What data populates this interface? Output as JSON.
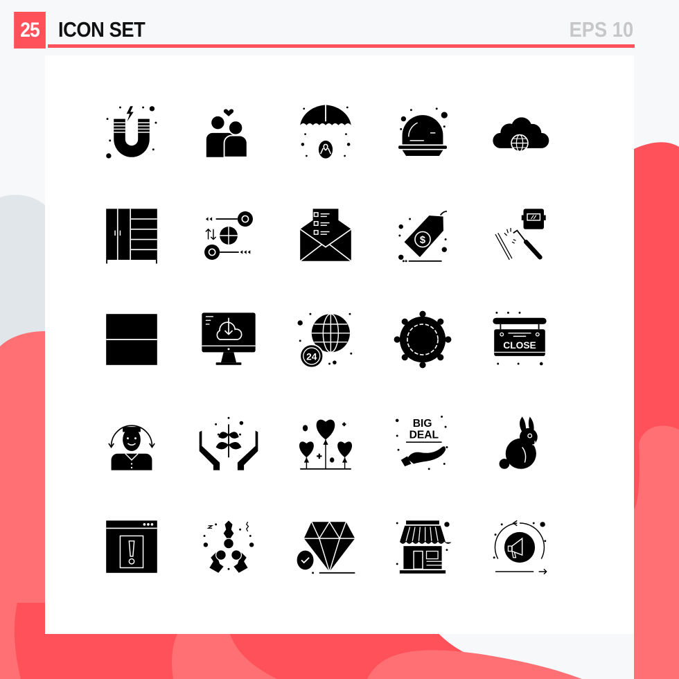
{
  "header": {
    "count_badge": "25",
    "title": "ICON SET",
    "format_label": "EPS 10"
  },
  "colors": {
    "accent": "#ff5159",
    "accent_light": "#ff7074",
    "grey_shape": "#e1e6ea",
    "background": "#f7f8fa",
    "card": "#ffffff",
    "icon": "#000000",
    "format_label": "#c7c7c9"
  },
  "icons": [
    {
      "row": 1,
      "col": 1,
      "name": "magnet-icon"
    },
    {
      "row": 1,
      "col": 2,
      "name": "couple-love-icon"
    },
    {
      "row": 1,
      "col": 3,
      "name": "umbrella-ribbon-icon"
    },
    {
      "row": 1,
      "col": 4,
      "name": "food-cloche-icon"
    },
    {
      "row": 1,
      "col": 5,
      "name": "cloud-globe-icon"
    },
    {
      "row": 2,
      "col": 1,
      "name": "wardrobe-icon"
    },
    {
      "row": 2,
      "col": 2,
      "name": "puzzle-keys-icon"
    },
    {
      "row": 2,
      "col": 3,
      "name": "envelope-checklist-icon"
    },
    {
      "row": 2,
      "col": 4,
      "name": "dollar-price-tag-icon",
      "text": "$"
    },
    {
      "row": 2,
      "col": 5,
      "name": "welding-icon"
    },
    {
      "row": 3,
      "col": 1,
      "name": "split-rows-icon"
    },
    {
      "row": 3,
      "col": 2,
      "name": "computer-cloud-download-icon"
    },
    {
      "row": 3,
      "col": 3,
      "name": "globe-24-hours-icon",
      "text": "24"
    },
    {
      "row": 3,
      "col": 4,
      "name": "ship-wheel-icon"
    },
    {
      "row": 3,
      "col": 5,
      "name": "close-sign-icon",
      "text": "CLOSE"
    },
    {
      "row": 4,
      "col": 1,
      "name": "user-rotate-icon"
    },
    {
      "row": 4,
      "col": 2,
      "name": "hands-plant-icon"
    },
    {
      "row": 4,
      "col": 3,
      "name": "heart-balloons-icon"
    },
    {
      "row": 4,
      "col": 4,
      "name": "big-deal-hand-icon",
      "text": "BIG DEAL"
    },
    {
      "row": 4,
      "col": 5,
      "name": "easter-bunny-icon"
    },
    {
      "row": 5,
      "col": 1,
      "name": "browser-warning-icon",
      "text": "!"
    },
    {
      "row": 5,
      "col": 2,
      "name": "holly-berries-icon"
    },
    {
      "row": 5,
      "col": 3,
      "name": "diamond-check-icon"
    },
    {
      "row": 5,
      "col": 4,
      "name": "shop-store-icon"
    },
    {
      "row": 5,
      "col": 5,
      "name": "megaphone-cycle-icon"
    }
  ]
}
